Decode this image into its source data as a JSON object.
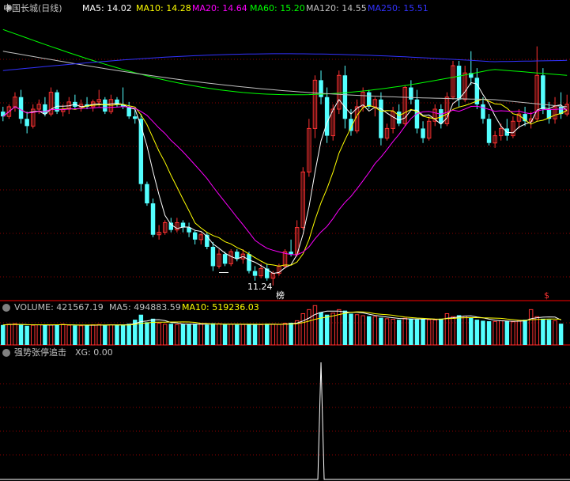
{
  "main_header": {
    "stock_title": "中国长城(日线)",
    "ma5": "MA5: 14.02",
    "ma10": "MA10: 14.28",
    "ma20": "MA20: 14.64",
    "ma60": "MA60: 15.20",
    "ma120": "MA120: 14.55",
    "ma250": "MA250: 15.51"
  },
  "volume_header": {
    "title": "VOLUME: 421567.19",
    "ma5": "MA5: 494883.59",
    "ma10": "MA10: 519236.03"
  },
  "indicator_header": {
    "title": "强势张停追击",
    "xg": "XG: 0.00"
  },
  "annotations": {
    "low_price": "11.24",
    "badge_bang": "榜",
    "badge_dollar": "$"
  },
  "colors": {
    "background": "#000000",
    "up": "#ff3232",
    "down": "#54ffff",
    "ma5": "#ffffff",
    "ma10": "#ffff00",
    "ma20": "#ff00ff",
    "ma60": "#00ff00",
    "ma120": "#c0c0c0",
    "ma250": "#3232ff",
    "grid": "#8b0000",
    "separator": "#ff0000"
  },
  "chart_data": {
    "type": "candlestick",
    "price": {
      "ohlc": [
        [
          14.45,
          14.55,
          14.25,
          14.35
        ],
        [
          14.35,
          14.6,
          14.3,
          14.55
        ],
        [
          14.55,
          14.85,
          14.45,
          14.75
        ],
        [
          14.75,
          14.9,
          14.2,
          14.3
        ],
        [
          14.3,
          14.45,
          14.0,
          14.15
        ],
        [
          14.15,
          14.6,
          14.1,
          14.5
        ],
        [
          14.5,
          14.7,
          14.4,
          14.6
        ],
        [
          14.6,
          14.75,
          14.35,
          14.4
        ],
        [
          14.4,
          14.95,
          14.35,
          14.85
        ],
        [
          14.85,
          14.9,
          14.4,
          14.45
        ],
        [
          14.45,
          14.6,
          14.35,
          14.5
        ],
        [
          14.5,
          14.75,
          14.4,
          14.65
        ],
        [
          14.65,
          14.8,
          14.5,
          14.55
        ],
        [
          14.55,
          14.7,
          14.45,
          14.6
        ],
        [
          14.6,
          14.75,
          14.5,
          14.55
        ],
        [
          14.55,
          14.7,
          14.45,
          14.65
        ],
        [
          14.65,
          14.9,
          14.55,
          14.7
        ],
        [
          14.7,
          14.75,
          14.4,
          14.45
        ],
        [
          14.45,
          14.8,
          14.4,
          14.7
        ],
        [
          14.7,
          14.75,
          14.55,
          14.6
        ],
        [
          14.6,
          14.95,
          14.5,
          14.55
        ],
        [
          14.55,
          14.65,
          14.3,
          14.35
        ],
        [
          14.35,
          14.5,
          14.2,
          14.3
        ],
        [
          14.3,
          14.4,
          12.8,
          12.95
        ],
        [
          12.95,
          13.0,
          12.5,
          12.55
        ],
        [
          12.55,
          12.65,
          11.85,
          11.9
        ],
        [
          11.9,
          12.1,
          11.8,
          11.95
        ],
        [
          11.95,
          12.2,
          11.9,
          12.15
        ],
        [
          12.15,
          12.25,
          11.95,
          12.0
        ],
        [
          12.0,
          12.25,
          11.95,
          12.15
        ],
        [
          12.15,
          12.2,
          11.95,
          12.05
        ],
        [
          12.05,
          12.15,
          11.85,
          11.95
        ],
        [
          11.95,
          12.0,
          11.7,
          11.8
        ],
        [
          11.8,
          11.95,
          11.7,
          11.9
        ],
        [
          11.9,
          11.95,
          11.6,
          11.65
        ],
        [
          11.65,
          11.75,
          11.15,
          11.25
        ],
        [
          11.25,
          11.6,
          11.2,
          11.5
        ],
        [
          11.5,
          11.55,
          11.25,
          11.3
        ],
        [
          11.3,
          11.6,
          11.25,
          11.55
        ],
        [
          11.55,
          11.6,
          11.35,
          11.4
        ],
        [
          11.4,
          11.6,
          11.3,
          11.5
        ],
        [
          11.5,
          11.55,
          11.1,
          11.15
        ],
        [
          11.15,
          11.25,
          10.95,
          11.05
        ],
        [
          11.05,
          11.3,
          11.0,
          11.2
        ],
        [
          11.2,
          11.3,
          10.95,
          11.0
        ],
        [
          11.0,
          11.15,
          10.85,
          11.1
        ],
        [
          11.1,
          11.3,
          11.05,
          11.25
        ],
        [
          11.25,
          11.6,
          11.2,
          11.55
        ],
        [
          11.55,
          11.8,
          11.45,
          11.5
        ],
        [
          11.5,
          12.2,
          11.45,
          12.05
        ],
        [
          12.05,
          13.3,
          12.0,
          13.2
        ],
        [
          13.2,
          14.3,
          13.1,
          14.1
        ],
        [
          14.1,
          15.2,
          13.9,
          15.1
        ],
        [
          15.1,
          15.3,
          14.6,
          14.75
        ],
        [
          14.75,
          14.95,
          13.8,
          13.95
        ],
        [
          13.95,
          14.6,
          13.85,
          14.5
        ],
        [
          14.5,
          15.3,
          14.4,
          15.2
        ],
        [
          15.2,
          15.4,
          14.1,
          14.3
        ],
        [
          14.3,
          14.5,
          13.95,
          14.05
        ],
        [
          14.05,
          14.7,
          14.0,
          14.55
        ],
        [
          14.55,
          14.95,
          14.45,
          14.85
        ],
        [
          14.85,
          14.9,
          14.5,
          14.55
        ],
        [
          14.55,
          14.75,
          14.35,
          14.7
        ],
        [
          14.7,
          14.85,
          13.75,
          13.9
        ],
        [
          13.9,
          14.2,
          13.85,
          14.1
        ],
        [
          14.1,
          14.55,
          14.0,
          14.45
        ],
        [
          14.45,
          14.6,
          14.15,
          14.2
        ],
        [
          14.2,
          15.0,
          14.15,
          14.95
        ],
        [
          14.95,
          15.1,
          14.6,
          14.7
        ],
        [
          14.7,
          14.9,
          14.0,
          14.1
        ],
        [
          14.1,
          14.25,
          13.8,
          13.9
        ],
        [
          13.9,
          14.35,
          13.85,
          14.25
        ],
        [
          14.25,
          14.6,
          14.15,
          14.5
        ],
        [
          14.5,
          14.6,
          14.1,
          14.2
        ],
        [
          14.2,
          14.85,
          14.15,
          14.75
        ],
        [
          14.75,
          15.5,
          14.7,
          15.4
        ],
        [
          15.4,
          15.5,
          14.55,
          14.7
        ],
        [
          14.7,
          15.4,
          14.65,
          15.25
        ],
        [
          15.25,
          15.7,
          15.0,
          15.15
        ],
        [
          15.15,
          15.35,
          14.5,
          14.6
        ],
        [
          14.6,
          14.75,
          14.2,
          14.3
        ],
        [
          14.3,
          14.4,
          13.75,
          13.8
        ],
        [
          13.8,
          14.05,
          13.7,
          13.95
        ],
        [
          13.95,
          14.2,
          13.85,
          14.1
        ],
        [
          14.1,
          14.3,
          13.85,
          13.95
        ],
        [
          13.95,
          14.35,
          13.9,
          14.25
        ],
        [
          14.25,
          14.5,
          14.1,
          14.4
        ],
        [
          14.4,
          14.55,
          14.15,
          14.25
        ],
        [
          14.25,
          14.45,
          14.1,
          14.3
        ],
        [
          14.3,
          15.8,
          14.25,
          15.2
        ],
        [
          15.2,
          15.35,
          14.4,
          14.5
        ],
        [
          14.5,
          14.65,
          14.2,
          14.3
        ],
        [
          14.3,
          14.75,
          14.2,
          14.55
        ],
        [
          14.55,
          14.85,
          14.3,
          14.4
        ],
        [
          14.4,
          14.8,
          14.35,
          14.6
        ]
      ],
      "volume": [
        395000,
        410000,
        420000,
        400000,
        380000,
        390000,
        400000,
        405000,
        395000,
        400000,
        410000,
        390000,
        385000,
        380000,
        395000,
        400000,
        405000,
        390000,
        400000,
        395000,
        400000,
        420000,
        500000,
        600000,
        450000,
        520000,
        430000,
        410000,
        420000,
        400000,
        410000,
        415000,
        420000,
        410000,
        400000,
        430000,
        420000,
        405000,
        410000,
        400000,
        405000,
        410000,
        415000,
        400000,
        420000,
        410000,
        405000,
        430000,
        440000,
        480000,
        620000,
        700000,
        780000,
        650000,
        600000,
        630000,
        700000,
        680000,
        620000,
        600000,
        580000,
        570000,
        560000,
        540000,
        520000,
        510000,
        500000,
        530000,
        520000,
        505000,
        510000,
        500000,
        495000,
        520000,
        620000,
        560000,
        590000,
        570000,
        540000,
        500000,
        480000,
        470000,
        465000,
        480000,
        470000,
        460000,
        475000,
        500000,
        700000,
        560000,
        520000,
        500000,
        480000,
        421567
      ],
      "ylim": [
        10.7,
        16.4
      ],
      "vol_max": 800000,
      "low_index": 36,
      "badge_bang_index": 53,
      "badge_dollar_index": 92
    },
    "indicator": {
      "name": "XG",
      "spike_index": 53,
      "spike_value": 1
    },
    "ma_last": {
      "MA5": 14.02,
      "MA10": 14.28,
      "MA20": 14.64,
      "MA60": 15.2,
      "MA120": 14.55,
      "MA250": 15.51
    }
  }
}
